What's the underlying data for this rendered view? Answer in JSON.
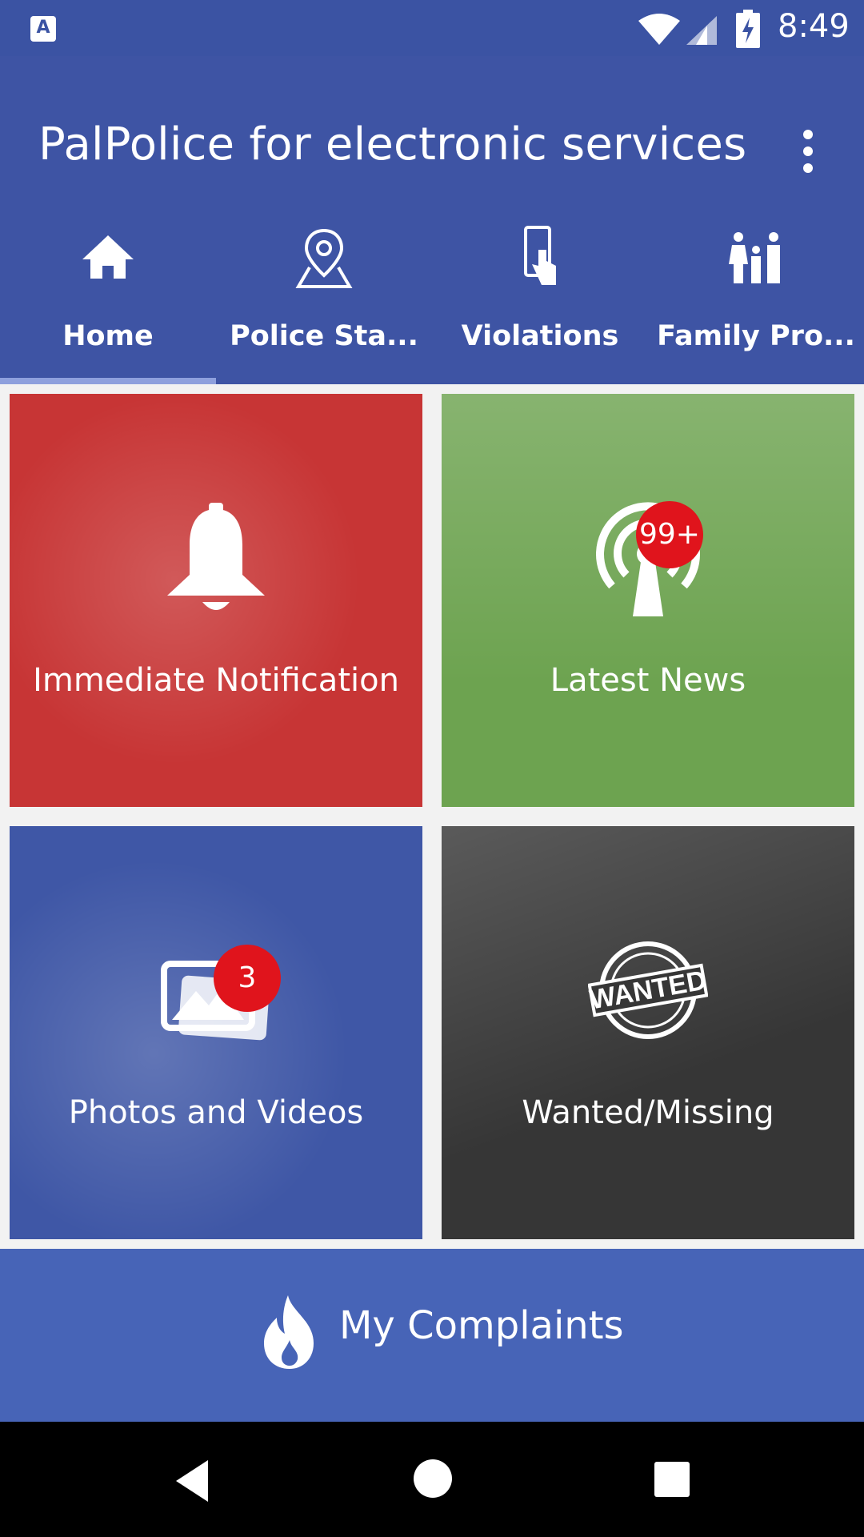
{
  "status_bar": {
    "time": "8:49",
    "notification_icon": "A",
    "icons": [
      "wifi-icon",
      "cell-signal-icon",
      "battery-charging-icon"
    ]
  },
  "app_bar": {
    "title": "PalPolice for electronic services",
    "overflow_icon": "more-vert-icon"
  },
  "tabs": [
    {
      "label": "Home",
      "icon": "home-icon",
      "selected": true
    },
    {
      "label": "Police Sta...",
      "icon": "map-pin-icon",
      "selected": false
    },
    {
      "label": "Violations",
      "icon": "phone-touch-icon",
      "selected": false
    },
    {
      "label": "Family Pro...",
      "icon": "family-icon",
      "selected": false
    }
  ],
  "tiles": [
    {
      "label": "Immediate Notification",
      "icon": "bell-icon",
      "color": "#c73535",
      "badge": ""
    },
    {
      "label": "Latest News",
      "icon": "broadcast-icon",
      "color": "#6da350",
      "badge": "99+"
    },
    {
      "label": "Photos and Videos",
      "icon": "photos-icon",
      "color": "#3f57a6",
      "badge": "3"
    },
    {
      "label": "Wanted/Missing",
      "icon": "wanted-stamp-icon",
      "color": "#363636",
      "badge": "",
      "stamp_text": "WANTED"
    }
  ],
  "complaints": {
    "label": "My Complaints",
    "icon": "fire-icon",
    "color": "#4764b7"
  },
  "nav_bar": {
    "icons": [
      "back-icon",
      "home-circle-icon",
      "recents-icon"
    ]
  },
  "colors": {
    "primary": "#3e54a4",
    "badge": "#e0141c"
  }
}
